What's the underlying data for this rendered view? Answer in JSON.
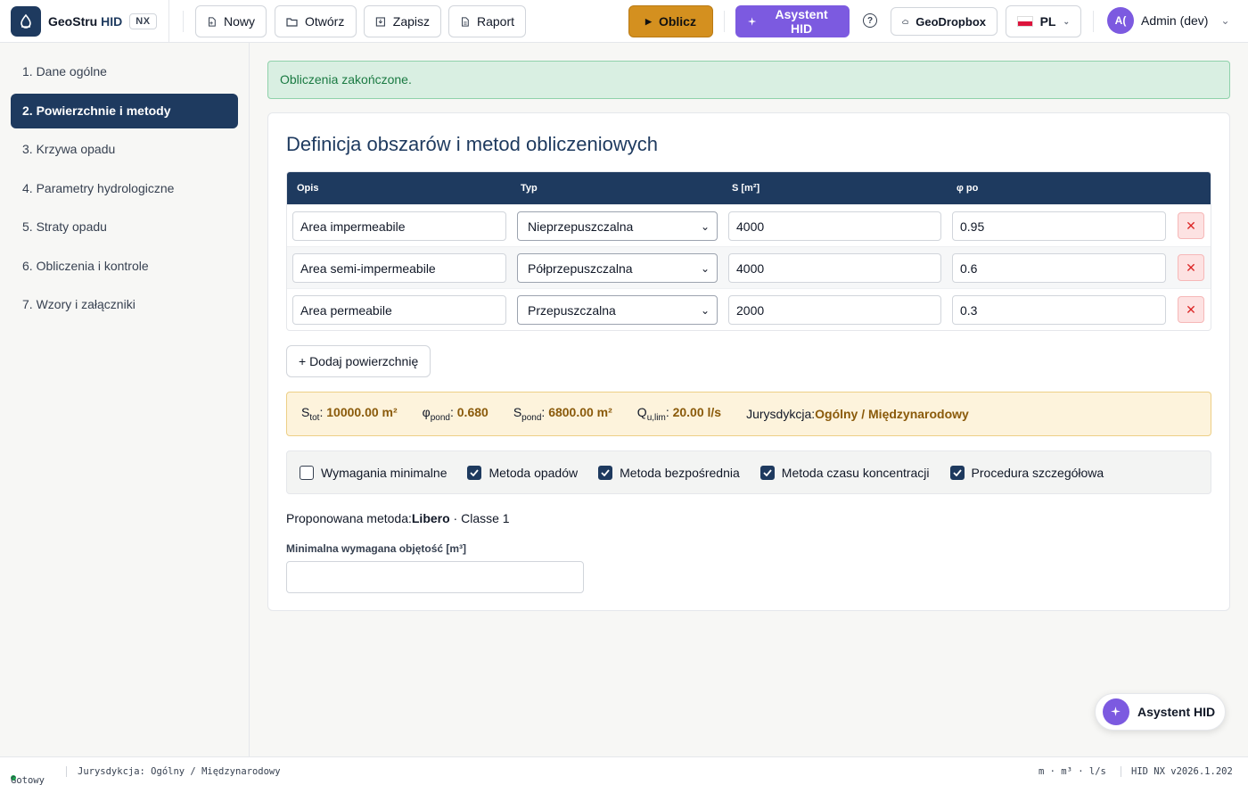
{
  "header": {
    "brand_name": "GeoStru",
    "brand_accent": "HID",
    "brand_badge": "NX",
    "new_label": "Nowy",
    "open_label": "Otwórz",
    "save_label": "Zapisz",
    "report_label": "Raport",
    "calculate_label": "Oblicz",
    "assistant_label": "Asystent HID",
    "help_label": "?",
    "dropbox_label": "GeoDropbox",
    "language": "PL",
    "avatar_initials": "A(",
    "user_name": "Admin (dev)"
  },
  "sidebar": {
    "items": [
      {
        "label": "1. Dane ogólne"
      },
      {
        "label": "2. Powierzchnie i metody"
      },
      {
        "label": "3. Krzywa opadu"
      },
      {
        "label": "4. Parametry hydrologiczne"
      },
      {
        "label": "5. Straty opadu"
      },
      {
        "label": "6. Obliczenia i kontrole"
      },
      {
        "label": "7. Wzory i załączniki"
      }
    ]
  },
  "alert": {
    "text": "Obliczenia zakończone."
  },
  "section": {
    "title": "Definicja obszarów i metod obliczeniowych"
  },
  "table": {
    "headers": {
      "description": "Opis",
      "type": "Typ",
      "area": "S [m²]",
      "phi": "φ po"
    },
    "rows": [
      {
        "description": "Area impermeabile",
        "type": "Nieprzepuszczalna",
        "area": "4000",
        "phi": "0.95"
      },
      {
        "description": "Area semi-impermeabile",
        "type": "Półprzepuszczalna",
        "area": "4000",
        "phi": "0.6"
      },
      {
        "description": "Area permeabile",
        "type": "Przepuszczalna",
        "area": "2000",
        "phi": "0.3"
      }
    ],
    "delete_label": "✕"
  },
  "add_surface_label": "+ Dodaj powierzchnię",
  "summary": {
    "s_tot_main": "S",
    "s_tot_sub": "tot",
    "s_tot_value": "10000.00 m²",
    "phi_main": "φ",
    "phi_sub": "pond",
    "phi_value": "0.680",
    "s_pond_main": "S",
    "s_pond_sub": "pond",
    "s_pond_value": "6800.00 m²",
    "q_main": "Q",
    "q_sub": "u,lim",
    "q_value": "20.00 l/s",
    "jurisdiction_label": "Jurysdykcja:",
    "jurisdiction_value": "Ogólny / Międzynarodowy"
  },
  "methods": [
    {
      "label": "Wymagania minimalne",
      "checked": false
    },
    {
      "label": "Metoda opadów",
      "checked": true
    },
    {
      "label": "Metoda bezpośrednia",
      "checked": true
    },
    {
      "label": "Metoda czasu koncentracji",
      "checked": true
    },
    {
      "label": "Procedura szczegółowa",
      "checked": true
    }
  ],
  "proposed": {
    "label": "Proponowana metoda:",
    "method": "Libero",
    "suffix": " · Classe 1"
  },
  "min_volume": {
    "label": "Minimalna wymagana objętość [m³]",
    "value": ""
  },
  "fab": {
    "label": "Asystent HID"
  },
  "statusbar": {
    "status": "Gotowy",
    "jurisdiction": "Jurysdykcja: Ogólny / Międzynarodowy",
    "units": "m · m³ · l/s",
    "version": "HID NX v2026.1.202"
  },
  "colors": {
    "primary": "#1e3a5f",
    "calculate": "#d4901f",
    "assistant": "#7c5ae0",
    "success": "#1a7a42",
    "danger": "#dc2626"
  }
}
